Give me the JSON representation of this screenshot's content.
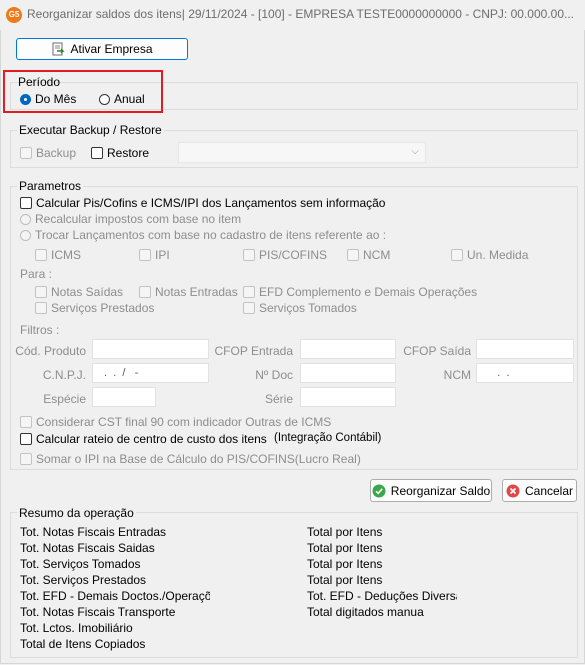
{
  "window": {
    "title": "Reorganizar saldos dos itens|  29/11/2024 - [100] - EMPRESA TESTE0000000000 - CNPJ: 00.000.00...",
    "app_icon_text": "G5"
  },
  "toolbar": {
    "ativar_empresa": "Ativar Empresa"
  },
  "periodo": {
    "title": "Período",
    "options": [
      {
        "label": "Do Mês",
        "checked": true
      },
      {
        "label": "Anual",
        "checked": false
      }
    ]
  },
  "backup": {
    "title": "Executar Backup / Restore",
    "backup_label": "Backup",
    "restore_label": "Restore"
  },
  "parametros": {
    "title": "Parametros",
    "calc_piscofins": "Calcular Pis/Cofins e ICMS/IPI dos Lançamentos sem informação",
    "recalcular": "Recalcular impostos com base no item",
    "trocar": "Trocar Lançamentos com base no cadastro de itens referente ao :",
    "trocar_options": [
      "ICMS",
      "IPI",
      "PIS/COFINS",
      "NCM",
      "Un. Medida"
    ],
    "para_label": "Para :",
    "para_options": [
      "Notas Saídas",
      "Notas Entradas",
      "EFD Complemento e Demais Operações",
      "Serviços Prestados",
      "Serviços Tomados"
    ],
    "filtros_label": "Filtros :",
    "filtros": {
      "cod_produto": "Cód. Produto",
      "cfop_entrada": "CFOP Entrada",
      "cfop_saida": "CFOP Saída",
      "cnpj": "C.N.P.J.",
      "cnpj_value": " .  .  /   -",
      "num_doc": "Nº Doc",
      "ncm": "NCM",
      "ncm_value": "    .  .",
      "especie": "Espécie",
      "serie": "Série"
    },
    "considerar_cst": "Considerar CST final 90 com indicador Outras de ICMS",
    "calcular_rateio": "Calcular rateio de centro de custo dos itens",
    "integracao": "(Integração Contábil)",
    "somar_ipi": "Somar o IPI na Base de Cálculo do PIS/COFINS(Lucro Real)"
  },
  "actions": {
    "reorganizar": "Reorganizar Saldo",
    "cancelar": "Cancelar"
  },
  "resumo": {
    "title": "Resumo da operação",
    "left": [
      "Tot. Notas Fiscais Entradas",
      "Tot. Notas Fiscais Saidas",
      "Tot. Serviços Tomados",
      "Tot. Serviços Prestados",
      "Tot. EFD - Demais Doctos./Operações",
      "Tot. Notas Fiscais Transporte",
      "Tot. Lctos. Imobiliário",
      "Total de Itens Copiados"
    ],
    "right": [
      "Total por Itens",
      "Total por Itens",
      "Total por Itens",
      "Total por Itens",
      "Tot. EFD - Deduções Diversas",
      "Total digitados manua"
    ]
  },
  "colors": {
    "accent": "#0067c0",
    "highlight": "#e31b23"
  }
}
